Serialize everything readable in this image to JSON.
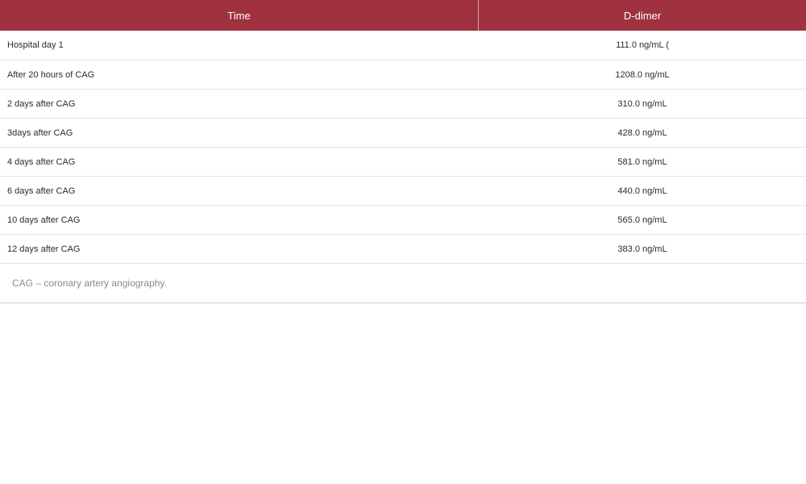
{
  "table": {
    "headers": {
      "time": "Time",
      "ddimer": "D-dimer"
    },
    "rows": [
      {
        "time": "Hospital day 1",
        "ddimer": "111.0 ng/mL ("
      },
      {
        "time": "After 20 hours of CAG",
        "ddimer": "1208.0 ng/mL"
      },
      {
        "time": "2 days after CAG",
        "ddimer": "310.0 ng/mL"
      },
      {
        "time": "3days after CAG",
        "ddimer": "428.0 ng/mL"
      },
      {
        "time": "4 days after CAG",
        "ddimer": "581.0 ng/mL"
      },
      {
        "time": "6 days after CAG",
        "ddimer": "440.0 ng/mL"
      },
      {
        "time": "10 days after CAG",
        "ddimer": "565.0 ng/mL"
      },
      {
        "time": "12 days after CAG",
        "ddimer": "383.0 ng/mL"
      }
    ],
    "footnote": "CAG – coronary artery angiography."
  },
  "colors": {
    "header_background": "#a0313e",
    "header_text": "#ffffff"
  }
}
